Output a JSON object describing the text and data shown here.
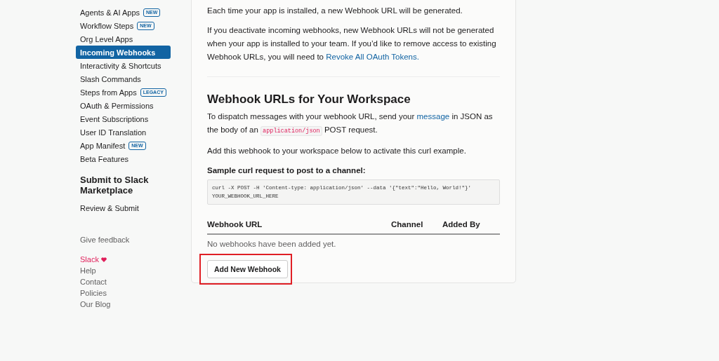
{
  "sidebar": {
    "items": [
      {
        "label": "Agents & AI Apps",
        "badge": "NEW",
        "selected": false
      },
      {
        "label": "Workflow Steps",
        "badge": "NEW",
        "selected": false
      },
      {
        "label": "Org Level Apps",
        "selected": false
      },
      {
        "label": "Incoming Webhooks",
        "selected": true
      },
      {
        "label": "Interactivity & Shortcuts",
        "selected": false
      },
      {
        "label": "Slash Commands",
        "selected": false
      },
      {
        "label": "Steps from Apps",
        "badge": "LEGACY",
        "selected": false
      },
      {
        "label": "OAuth & Permissions",
        "selected": false
      },
      {
        "label": "Event Subscriptions",
        "selected": false
      },
      {
        "label": "User ID Translation",
        "selected": false
      },
      {
        "label": "App Manifest",
        "badge": "NEW",
        "selected": false
      },
      {
        "label": "Beta Features",
        "selected": false
      }
    ],
    "section_title": "Submit to Slack Marketplace",
    "section_items": [
      "Review & Submit"
    ],
    "feedback": "Give feedback",
    "footer_brand": "Slack",
    "footer_links": [
      "Help",
      "Contact",
      "Policies",
      "Our Blog"
    ]
  },
  "content": {
    "intro": "Each time your app is installed, a new Webhook URL will be generated.",
    "deactivate_text": "If you deactivate incoming webhooks, new Webhook URLs will not be generated when your app is installed to your team. If you’d like to remove access to existing Webhook URLs, you will need to",
    "revoke_link": "Revoke All OAuth Tokens.",
    "heading": "Webhook URLs for Your Workspace",
    "dispatch_before": "To dispatch messages with your webhook URL, send your",
    "dispatch_link": "message",
    "dispatch_middle": "in JSON as the body of an",
    "dispatch_code": "application/json",
    "dispatch_after": "POST request.",
    "add_hint": "Add this webhook to your workspace below to activate this curl example.",
    "sample_label": "Sample curl request to post to a channel:",
    "sample_code": [
      "curl -X POST -H 'Content-type: application/json' --data '{\"text\":\"Hello, World!\"}'",
      "YOUR_WEBHOOK_URL_HERE"
    ],
    "table": {
      "columns": [
        "Webhook URL",
        "Channel",
        "Added By"
      ],
      "empty": "No webhooks have been added yet."
    },
    "add_button": {
      "label": "Add New Webhook",
      "highlighted": true
    }
  }
}
